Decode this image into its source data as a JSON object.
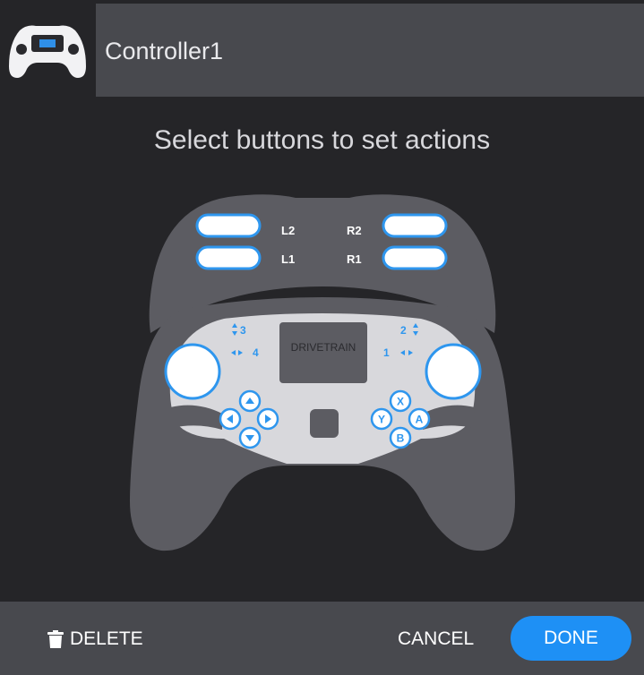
{
  "header": {
    "icon": "controller-icon",
    "title": "Controller1"
  },
  "prompt": "Select buttons to set actions",
  "controller": {
    "labels": {
      "l2": "L2",
      "r2": "R2",
      "l1": "L1",
      "r1": "R1",
      "screen": "DRIVETRAIN",
      "axis_3": "3",
      "axis_4": "4",
      "axis_2": "2",
      "axis_1": "1",
      "btn_x": "X",
      "btn_y": "Y",
      "btn_a": "A",
      "btn_b": "B"
    }
  },
  "footer": {
    "delete_label": "DELETE",
    "cancel_label": "CANCEL",
    "done_label": "DONE"
  },
  "colors": {
    "accent": "#1e90f5",
    "body": "#5c5c62",
    "panel": "#d8d8dc"
  }
}
